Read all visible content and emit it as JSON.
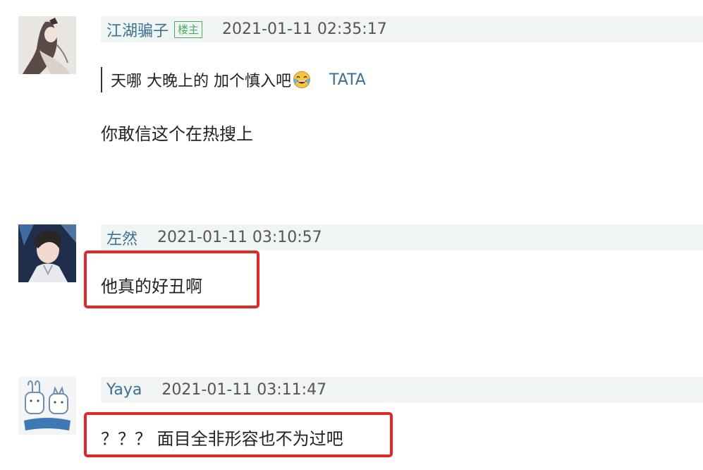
{
  "comments": [
    {
      "username": "江湖骗子",
      "badge": "楼主",
      "timestamp": "2021-01-11 02:35:17",
      "quote": {
        "text": "天哪 大晚上的 加个慎入吧",
        "emoji": "laughing-tears-emoji",
        "author": "TATA"
      },
      "body": "你敢信这个在热搜上",
      "avatar_icon": "anime-character-avatar-icon"
    },
    {
      "username": "左然",
      "timestamp": "2021-01-11 03:10:57",
      "body": "他真的好丑啊",
      "avatar_icon": "anime-man-avatar-icon",
      "highlighted": true
    },
    {
      "username": "Yaya",
      "timestamp": "2021-01-11 03:11:47",
      "body": "？？？ 面目全非形容也不为过吧",
      "avatar_icon": "bunny-cartoon-avatar-icon",
      "highlighted": true
    }
  ],
  "colors": {
    "username": "#3e6f94",
    "badge": "#4caa5f",
    "meta_background": "#f0f5f3",
    "highlight": "#e3262a"
  }
}
